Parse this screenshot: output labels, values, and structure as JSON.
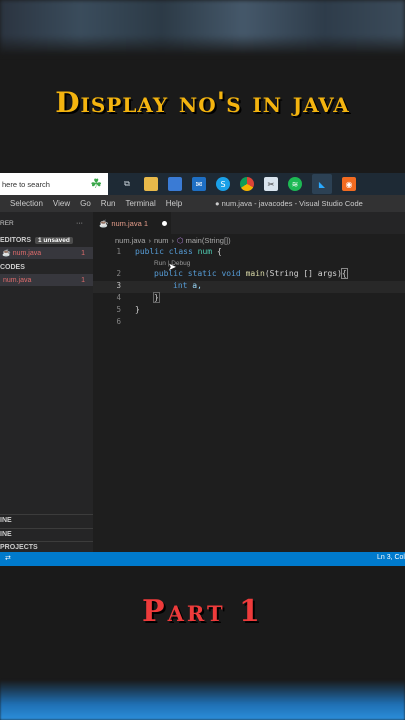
{
  "title": "Display no's in java",
  "taskbar": {
    "search_placeholder": "here to search",
    "icons": [
      "task-view-icon",
      "file-explorer-icon",
      "store-icon",
      "mail-icon",
      "skype-icon",
      "chrome-icon",
      "snipping-tool-icon",
      "spotify-icon",
      "vscode-icon",
      "app-icon"
    ]
  },
  "menubar": {
    "items": [
      "Selection",
      "View",
      "Go",
      "Run",
      "Terminal",
      "Help"
    ],
    "window_title": "● num.java - javacodes - Visual Studio Code"
  },
  "sidebar": {
    "explorer": "RER",
    "open_editors": "EDITORS",
    "unsaved_badge": "1 unsaved",
    "open_file": "num.java",
    "open_file_count": "1",
    "folder": "CODES",
    "folder_file": "num.java",
    "folder_file_count": "1",
    "outline": "INE",
    "timeline": "INE",
    "java_projects": "PROJECTS"
  },
  "editor": {
    "tab_label": "num.java 1",
    "breadcrumb": {
      "file": "num.java",
      "class": "num",
      "method": "main(String[])"
    },
    "codelens": "Run | Debug",
    "lines": [
      {
        "n": "1"
      },
      {
        "n": "2"
      },
      {
        "n": "3"
      },
      {
        "n": "4"
      },
      {
        "n": "5"
      },
      {
        "n": "6"
      }
    ],
    "code": {
      "l1_kw1": "public",
      "l1_kw2": "class",
      "l1_name": "num",
      "l1_brace": "{",
      "l2_kw1": "public",
      "l2_kw2": "static",
      "l2_kw3": "void",
      "l2_fn": "main",
      "l2_args": "(String [] args)",
      "l2_brace": "{",
      "l3_kw": "int",
      "l3_var": "a,",
      "l4": "}",
      "l5": "}"
    }
  },
  "statusbar": {
    "position": "Ln 3, Col"
  },
  "part_label": "Part 1"
}
